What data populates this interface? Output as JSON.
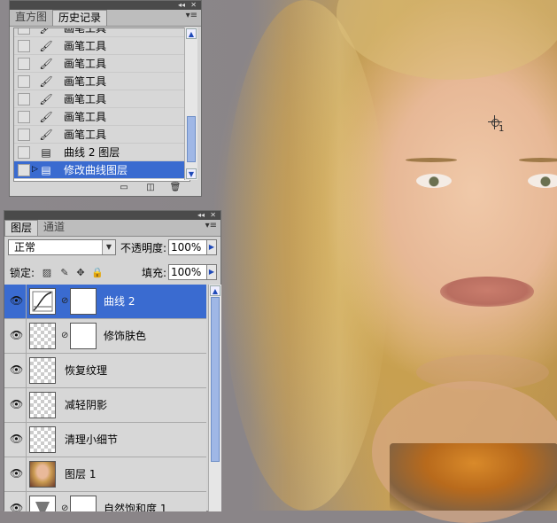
{
  "history_panel": {
    "tabs": [
      {
        "label": "直方图",
        "active": false
      },
      {
        "label": "历史记录",
        "active": true
      }
    ],
    "items": [
      {
        "label": "画笔工具",
        "icon": "brush-icon",
        "selected": false
      },
      {
        "label": "画笔工具",
        "icon": "brush-icon",
        "selected": false
      },
      {
        "label": "画笔工具",
        "icon": "brush-icon",
        "selected": false
      },
      {
        "label": "画笔工具",
        "icon": "brush-icon",
        "selected": false
      },
      {
        "label": "画笔工具",
        "icon": "brush-icon",
        "selected": false
      },
      {
        "label": "画笔工具",
        "icon": "brush-icon",
        "selected": false
      },
      {
        "label": "画笔工具",
        "icon": "brush-icon",
        "selected": false
      },
      {
        "label": "曲线 2 图层",
        "icon": "history-doc-icon",
        "selected": false
      },
      {
        "label": "修改曲线图层",
        "icon": "history-doc-icon",
        "selected": true
      }
    ],
    "footer_icons": [
      "new-document-from-state-icon",
      "create-snapshot-icon",
      "trash-icon"
    ]
  },
  "layers_panel": {
    "tabs": [
      {
        "label": "图层",
        "active": true
      },
      {
        "label": "通道",
        "active": false
      }
    ],
    "blend_mode": "正常",
    "opacity_label": "不透明度:",
    "opacity_value": "100%",
    "lock_label": "锁定:",
    "fill_label": "填充:",
    "fill_value": "100%",
    "layers": [
      {
        "name": "曲线 2",
        "visible": true,
        "selected": true,
        "thumb": "curves",
        "mask": true
      },
      {
        "name": "修饰肤色",
        "visible": true,
        "selected": false,
        "thumb": "transparent",
        "mask": true
      },
      {
        "name": "恢复纹理",
        "visible": true,
        "selected": false,
        "thumb": "transparent-sketch",
        "mask": false
      },
      {
        "name": "减轻阴影",
        "visible": true,
        "selected": false,
        "thumb": "transparent",
        "mask": false
      },
      {
        "name": "清理小细节",
        "visible": true,
        "selected": false,
        "thumb": "transparent",
        "mask": false
      },
      {
        "name": "图层 1",
        "visible": true,
        "selected": false,
        "thumb": "photo",
        "mask": false
      },
      {
        "name": "自然饱和度 1",
        "visible": true,
        "selected": false,
        "thumb": "vibrance",
        "mask": true
      }
    ]
  },
  "canvas": {
    "cursor_label": "1"
  },
  "colors": {
    "selection": "#3a6bd0",
    "panel_bg": "#d4d4d4",
    "titlebar": "#4a4a4a"
  }
}
